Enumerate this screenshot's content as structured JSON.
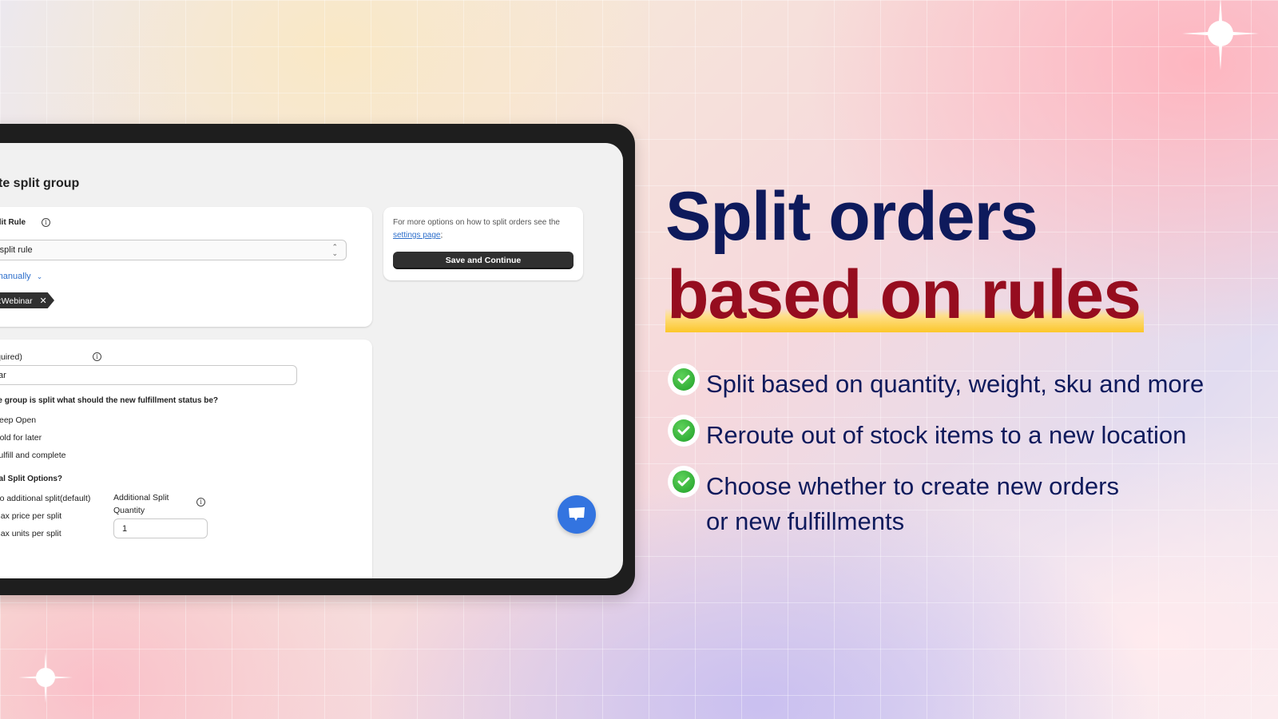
{
  "app": {
    "page_title": "Update split group",
    "split_rule_card": {
      "label": "Split Rule",
      "select_value": "Add split rule",
      "add_manually_label": "Add manually",
      "tag_label": "Type:Webinar"
    },
    "group_card": {
      "name_label": "Split group name (required)",
      "name_value": "Webinar",
      "status_question": "When the group is split what should the new fulfillment status be?",
      "status_options": [
        "Keep Open",
        "Hold for later",
        "Fulfill and complete"
      ],
      "additional_title": "Additional Split Options?",
      "additional_options": [
        "No additional split(default)",
        "Max price per split",
        "Max units per split"
      ],
      "quantity_label_line1": "Additional Split",
      "quantity_label_line2": "Quantity",
      "quantity_value": "1"
    },
    "side_card": {
      "text_prefix": "For more options on how to split orders see the",
      "link_text": "settings page",
      "text_suffix": ";",
      "save_button": "Save and Continue"
    },
    "chat_icon": "chat-bubble-icon"
  },
  "hero": {
    "headline_line1": "Split orders",
    "headline_line2": "based on rules",
    "features": [
      "Split based on quantity, weight, sku and more",
      "Reroute out of stock items to a new location",
      "Choose whether to create new orders",
      "or new fulfillments"
    ],
    "colors": {
      "navy": "#0e1a5c",
      "crimson": "#960d1f",
      "highlight": "#fcc72a",
      "check_green": "#20a028",
      "primary_blue": "#3374e0"
    }
  }
}
